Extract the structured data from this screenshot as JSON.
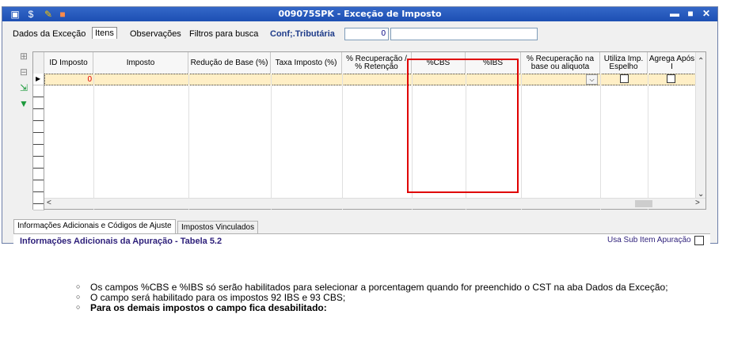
{
  "window": {
    "title": "009075SPK - Exceção de Imposto",
    "controls": {
      "minimize": "▬",
      "maximize": "■",
      "close": "✕"
    }
  },
  "tabs": [
    {
      "label": "Dados da Exceção"
    },
    {
      "label": "Itens"
    },
    {
      "label": "Observações"
    },
    {
      "label": "Filtros para busca"
    }
  ],
  "conf_tributaria": {
    "label": "Conf;.Tributária",
    "value": "0",
    "description": ""
  },
  "grid": {
    "columns": [
      "ID Imposto",
      "Imposto",
      "Redução de Base (%)",
      "Taxa Imposto (%)",
      "% Recuperação / % Retenção",
      "%CBS",
      "%IBS",
      "% Recuperação na base ou aliquota",
      "Utiliza Imp. Espelho",
      "Agrega Após I"
    ],
    "row": {
      "id_imposto": "0"
    }
  },
  "bottom_tabs": [
    {
      "label": "Informações Adicionais e Códigos de Ajuste"
    },
    {
      "label": "Impostos Vinculados"
    }
  ],
  "panel": {
    "title": "Informações Adicionais da Apuração - Tabela 5.2",
    "sub_item_label": "Usa Sub Item Apuração"
  },
  "notes": [
    "Os campos  %CBS e %IBS só serão habilitados para selecionar a porcentagem quando for preenchido o CST na aba Dados da Exceção;",
    "O campo será habilitado para os impostos 92 IBS e 93 CBS;",
    "Para os demais impostos o campo fica desabilitado:"
  ],
  "colors": {
    "highlight": "#e00000",
    "titlebar": "#2a5cc0",
    "selected_row": "#ffefc6"
  }
}
